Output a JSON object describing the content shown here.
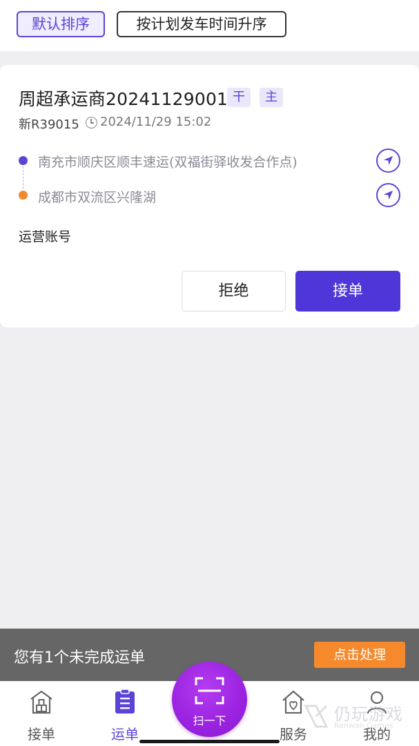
{
  "sort": {
    "default_label": "默认排序",
    "plan_label": "按计划发车时间升序"
  },
  "order": {
    "title": "周超承运商20241129001",
    "tags": [
      "干",
      "主"
    ],
    "plate": "新R39015",
    "datetime": "2024/11/29 15:02",
    "origin": "南充市顺庆区顺丰速运(双福街驿收发合作点)",
    "destination": "成都市双流区兴隆湖",
    "account_label": "运营账号",
    "reject_label": "拒绝",
    "accept_label": "接单"
  },
  "banner": {
    "text": "您有1个未完成运单",
    "action_label": "点击处理"
  },
  "tabbar": {
    "items": [
      {
        "label": "接单",
        "icon": "warehouse-icon",
        "active": false
      },
      {
        "label": "运单",
        "icon": "clipboard-icon",
        "active": true
      },
      {
        "label": "服务",
        "icon": "house-heart-icon",
        "active": false
      },
      {
        "label": "我的",
        "icon": "person-icon",
        "active": false
      }
    ],
    "scan_label": "扫一下"
  },
  "watermark": {
    "main": "仍玩游戏",
    "sub": "Renwan Games"
  },
  "colors": {
    "accent": "#5b43d6",
    "accept_button": "#4f36d8",
    "orange": "#f5892b",
    "scan_purple": "#9a22e0",
    "banner_bg": "#666666",
    "page_bg": "#efeff1"
  }
}
